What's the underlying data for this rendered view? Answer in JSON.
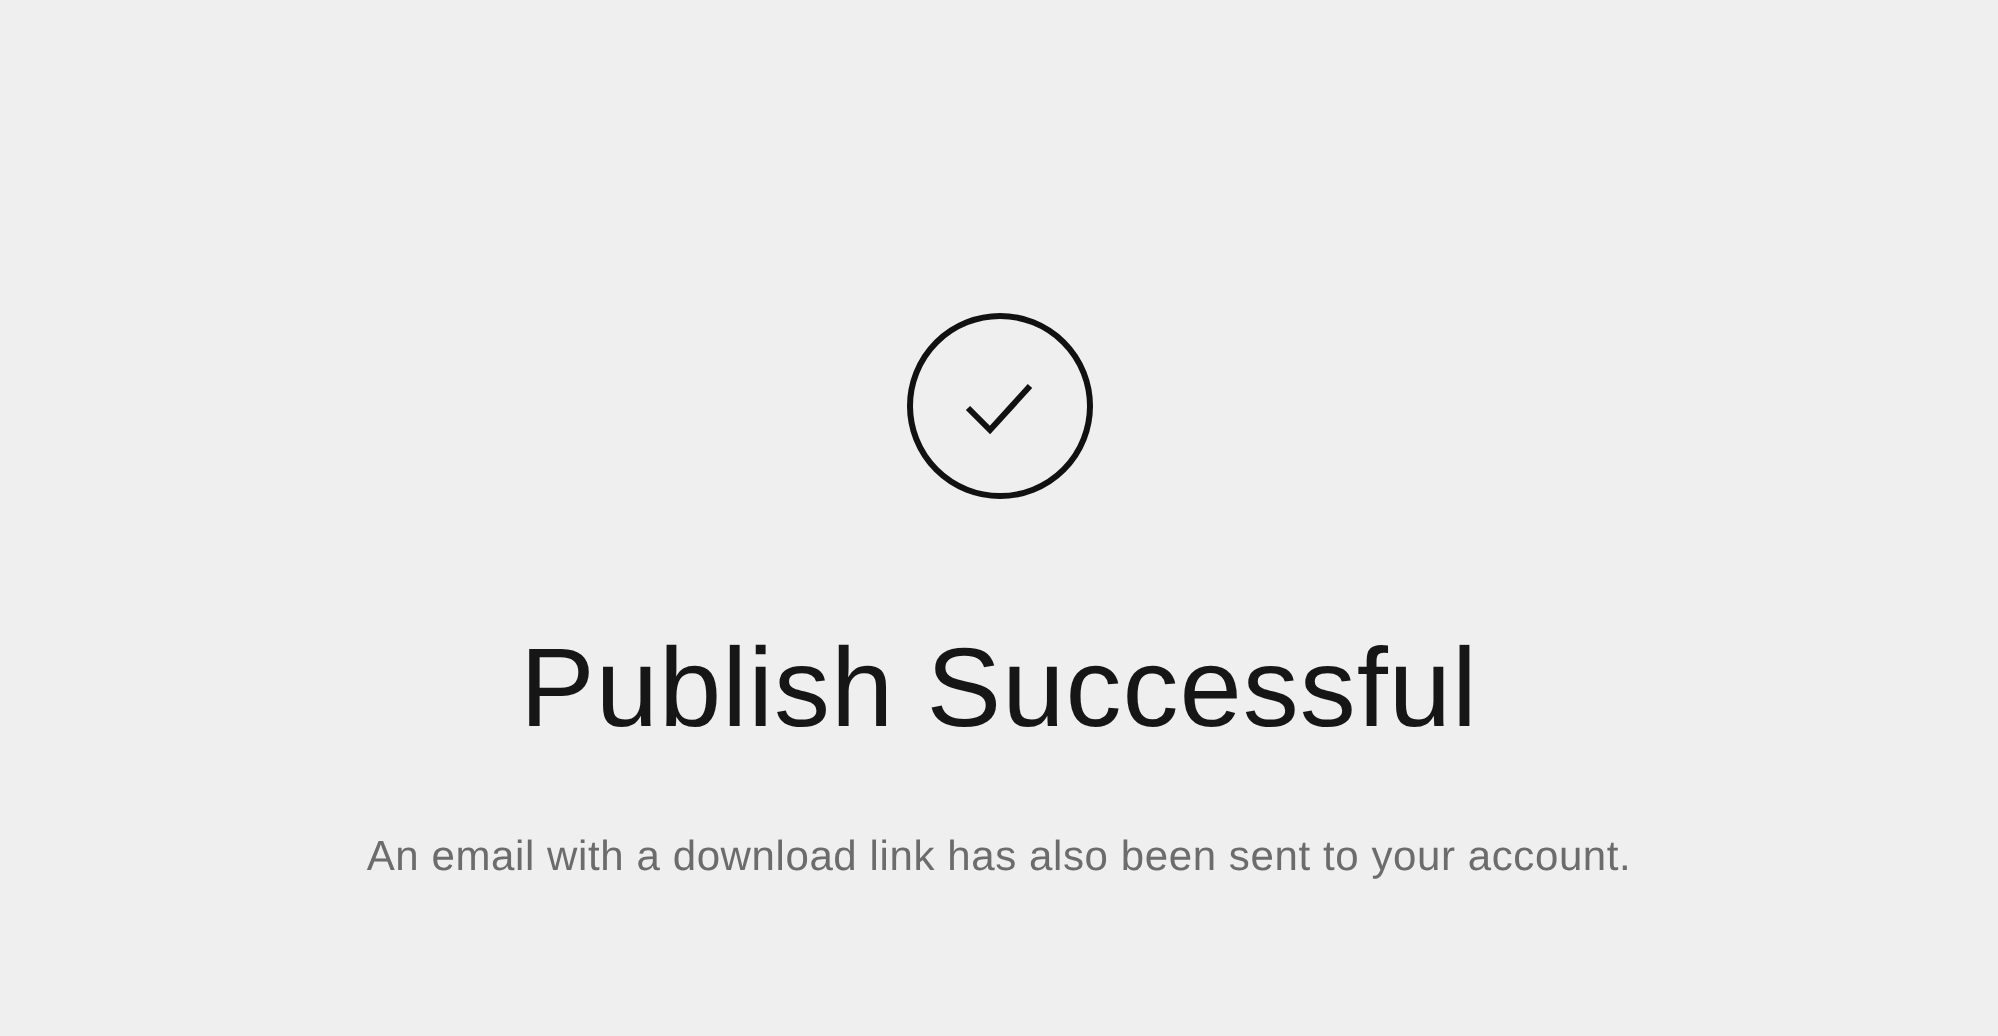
{
  "title": "Publish Successful",
  "message": "An email with a download link has also been sent to your account."
}
